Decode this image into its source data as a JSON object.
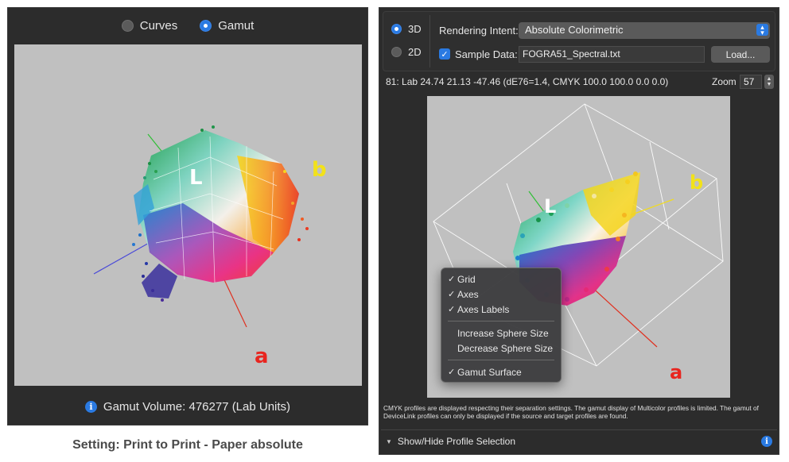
{
  "left": {
    "modes": {
      "curves": "Curves",
      "gamut": "Gamut",
      "selected": "Gamut"
    },
    "axis_labels": {
      "l": "L",
      "a": "a",
      "b": "b"
    },
    "footer": "Gamut Volume: 476277 (Lab Units)"
  },
  "caption": "Setting: Print to Print - Paper absolute",
  "right": {
    "dim": {
      "three_d": "3D",
      "two_d": "2D",
      "selected": "3D"
    },
    "rendering_intent": {
      "label": "Rendering Intent:",
      "value": "Absolute Colorimetric"
    },
    "sample_data": {
      "label": "Sample Data:",
      "checked": true,
      "file": "FOGRA51_Spectral.txt",
      "load_button": "Load..."
    },
    "status": "81: Lab 24.74  21.13 -47.46 (dE76=1.4, CMYK 100.0 100.0   0.0   0.0)",
    "zoom": {
      "label": "Zoom",
      "value": "57"
    },
    "axis_labels": {
      "l": "L",
      "a": "a",
      "b": "b"
    },
    "context_menu": {
      "items": [
        {
          "label": "Grid",
          "checked": true
        },
        {
          "label": "Axes",
          "checked": true
        },
        {
          "label": "Axes Labels",
          "checked": true
        },
        {
          "label": "Increase Sphere Size",
          "checked": false
        },
        {
          "label": "Decrease Sphere Size",
          "checked": false
        },
        {
          "label": "Gamut Surface",
          "checked": true
        }
      ]
    },
    "note": "CMYK profiles are displayed respecting their separation settings. The gamut display of Multicolor profiles is limited. The gamut of DeviceLink profiles can only be displayed if the source and target profiles are found.",
    "show_hide": "Show/Hide Profile Selection"
  },
  "colors": {
    "accent": "#2a7ae2",
    "panel": "#2c2c2c",
    "view_bg": "#c0c0c0",
    "l_label": "#ffffff",
    "a_label": "#e8251f",
    "b_label": "#f2e21a"
  }
}
